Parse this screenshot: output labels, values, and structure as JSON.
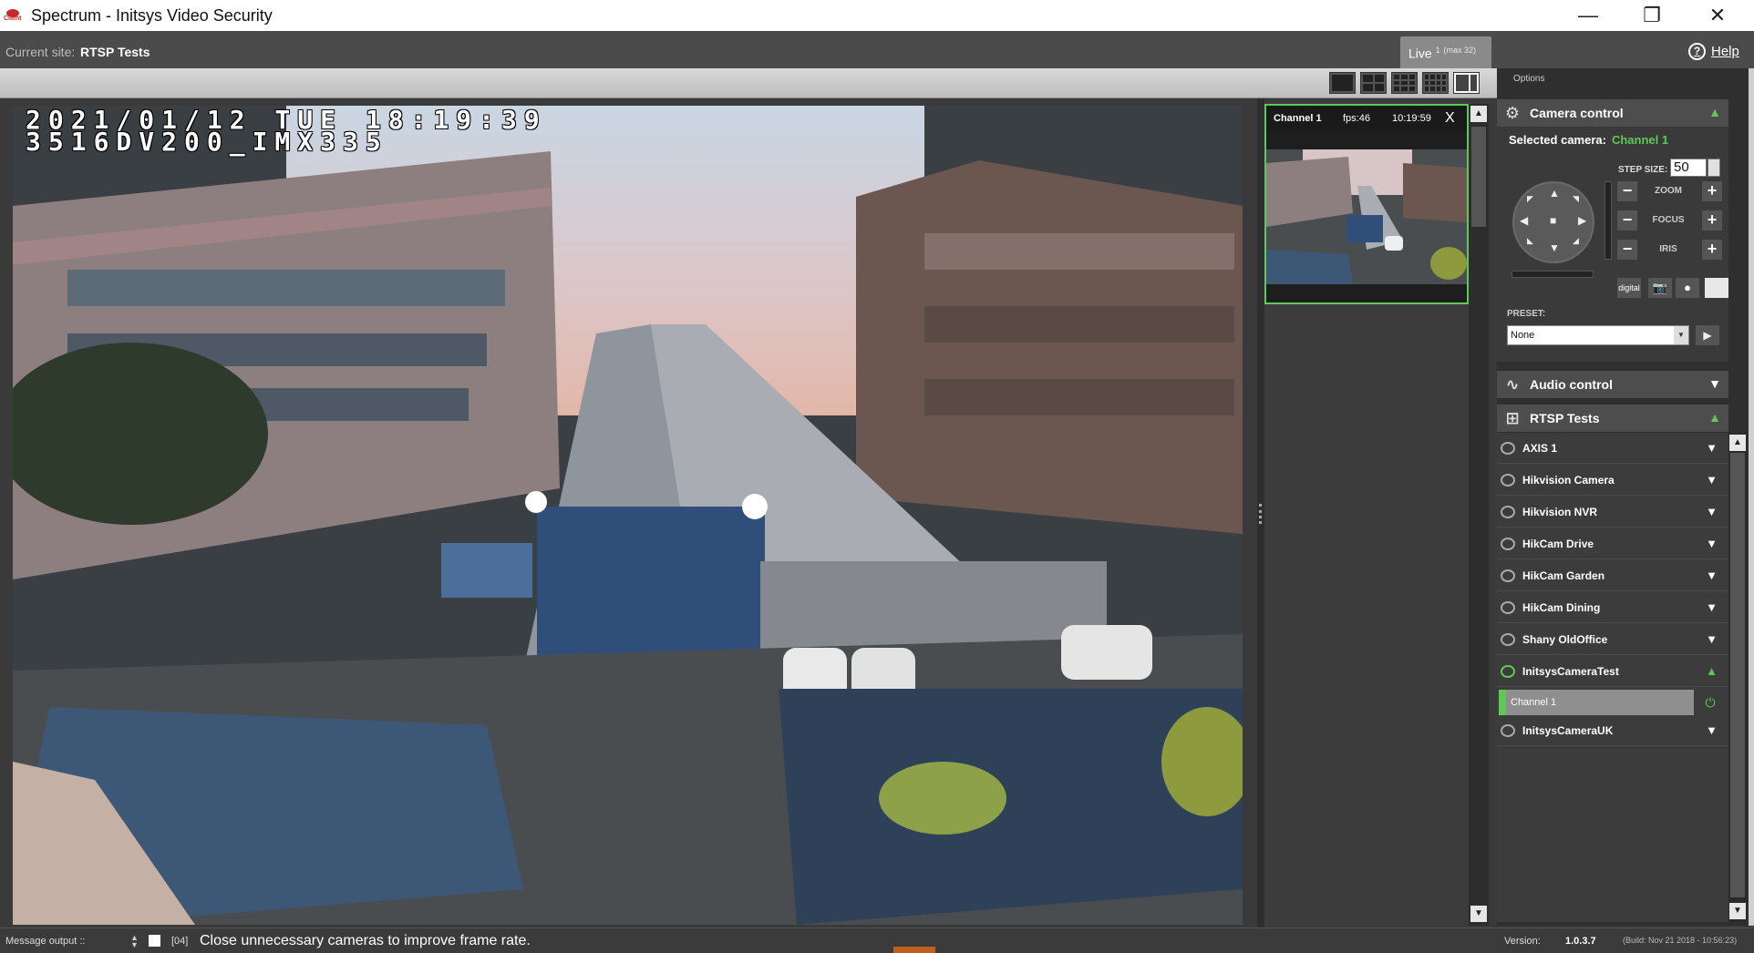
{
  "window": {
    "title": "Spectrum - Initsys Video Security",
    "logo_text": "Client",
    "minimize": "—",
    "restore": "❐",
    "close": "✕"
  },
  "site": {
    "label": "Current site:",
    "name": "RTSP Tests",
    "live_tab": "Live",
    "live_count": "1",
    "live_max": "(max 32)",
    "help": "Help",
    "help_glyph": "?"
  },
  "video": {
    "osd_line1": "2021/01/12 TUE 18:19:39",
    "osd_line2": "3516DV200_IMX335"
  },
  "channel_card": {
    "name": "Channel 1",
    "fps": "fps:46",
    "time": "10:19:59",
    "close": "X"
  },
  "options_tab": "Options",
  "camera_control": {
    "title": "Camera control",
    "selected_label": "Selected camera:",
    "selected_value": "Channel 1",
    "step_size_label": "STEP SIZE:",
    "step_size_value": "50",
    "zoom": "ZOOM",
    "focus": "FOCUS",
    "iris": "IRIS",
    "digital": "digital",
    "preset_label": "PRESET:",
    "preset_value": "None"
  },
  "audio_control": {
    "title": "Audio control"
  },
  "site_tree": {
    "title": "RTSP Tests",
    "cameras": [
      "AXIS 1",
      "Hikvision Camera",
      "Hikvision NVR",
      "HikCam Drive",
      "HikCam Garden",
      "HikCam Dining",
      "Shany OldOffice",
      "InitsysCameraTest",
      "InitsysCameraUK"
    ],
    "expanded_child": "Channel 1"
  },
  "status": {
    "message_label": "Message output ::",
    "code": "[04]",
    "message": "Close unnecessary cameras to improve frame rate.",
    "version_label": "Version:",
    "version": "1.0.3.7",
    "build": "(Build: Nov 21 2018 - 10:56:23)"
  },
  "colors": {
    "accent_green": "#5ec85a",
    "panel_dark": "#2f2f2f",
    "logo_red": "#c62a2a"
  }
}
